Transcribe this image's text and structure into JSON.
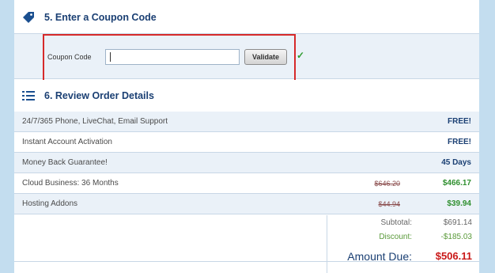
{
  "colors": {
    "sidebar": "#c3ddef",
    "header_text": "#1a3f73",
    "highlight_border": "#d62a2a",
    "free_price": "#1a3f73",
    "discount_price": "#2f8f2f",
    "amount_due": "#c91818"
  },
  "coupon_section": {
    "title": "5. Enter a Coupon Code",
    "icon": "tag-icon",
    "label": "Coupon Code",
    "input_value": "",
    "validate_label": "Validate",
    "status_icon": "check-icon",
    "status_glyph": "✓"
  },
  "order_section": {
    "title": "6. Review Order Details",
    "icon": "list-icon",
    "rows": [
      {
        "name": "24/7/365 Phone, LiveChat, Email Support",
        "old_price": "",
        "price": "FREE!"
      },
      {
        "name": "Instant Account Activation",
        "old_price": "",
        "price": "FREE!"
      },
      {
        "name": "Money Back Guarantee!",
        "old_price": "",
        "price": "45 Days"
      },
      {
        "name": "Cloud Business: 36 Months",
        "old_price": "$646.20",
        "price": "$466.17"
      },
      {
        "name": "Hosting Addons",
        "old_price": "$44.94",
        "price": "$39.94"
      }
    ]
  },
  "totals": {
    "subtotal_label": "Subtotal:",
    "subtotal_value": "$691.14",
    "discount_label": "Discount:",
    "discount_value": "-$185.03",
    "amount_due_label": "Amount Due:",
    "amount_due_value": "$506.11"
  }
}
